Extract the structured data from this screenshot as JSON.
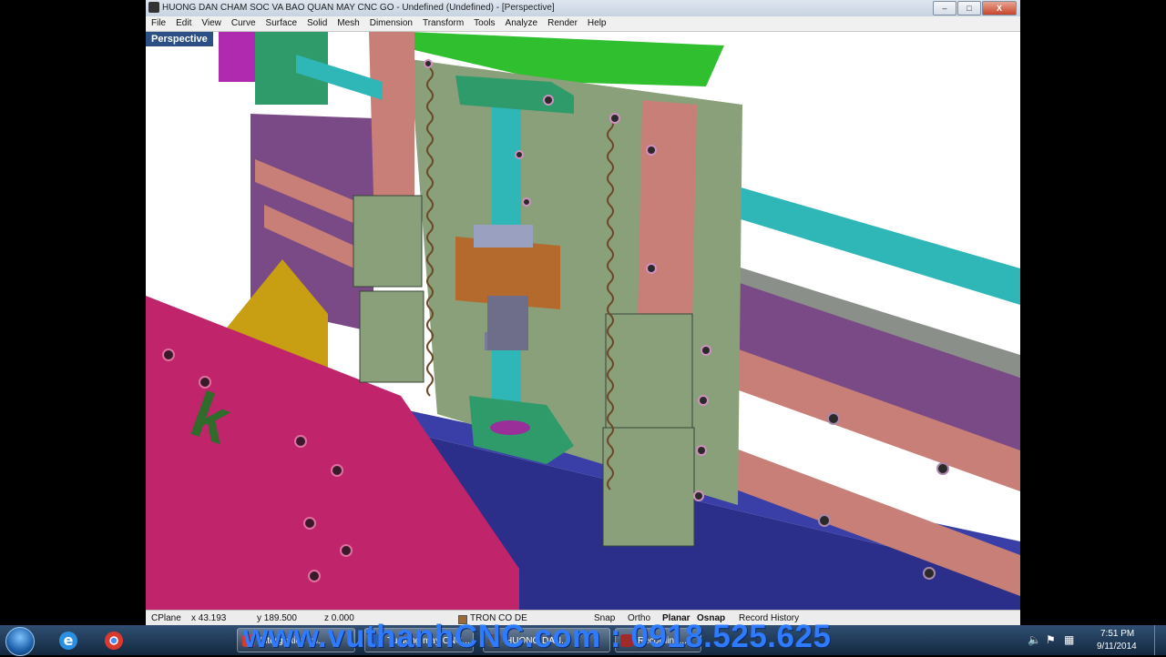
{
  "window": {
    "title": "HUONG DAN CHAM SOC VA BAO QUAN MAY CNC GO - Undefined (Undefined) - [Perspective]",
    "minimize_label": "–",
    "maximize_label": "□",
    "close_label": "X"
  },
  "menu": [
    "File",
    "Edit",
    "View",
    "Curve",
    "Surface",
    "Solid",
    "Mesh",
    "Dimension",
    "Transform",
    "Tools",
    "Analyze",
    "Render",
    "Help"
  ],
  "viewport": {
    "label": "Perspective"
  },
  "status": {
    "cplane": "CPlane",
    "x": "x 43.193",
    "y": "y 189.500",
    "z": "z 0.000",
    "layer": "TRON CO DE",
    "snap": "Snap",
    "ortho": "Ortho",
    "planar": "Planar",
    "osnap": "Osnap",
    "record_history": "Record History"
  },
  "watermark": "www.vuthanhCNC.com : 0918.525.625",
  "taskbar": {
    "items": [
      {
        "label": "Intergration im..."
      },
      {
        "label": "Tu dong may CNC..."
      },
      {
        "label": "HUONG DAN..."
      },
      {
        "label": "Recording..."
      }
    ],
    "time": "7:51 PM",
    "date": "9/11/2014"
  },
  "colors": {
    "viewport_label_bg": "#2c4f85",
    "gantry_plate": "#8aa07a",
    "rail": "#c77f78",
    "ballscrew": "#2fb6b6",
    "table_side": "#c0246a",
    "bed": "#2b2f8a",
    "beam": "#7a4a86",
    "watermark": "#2f7bff"
  }
}
